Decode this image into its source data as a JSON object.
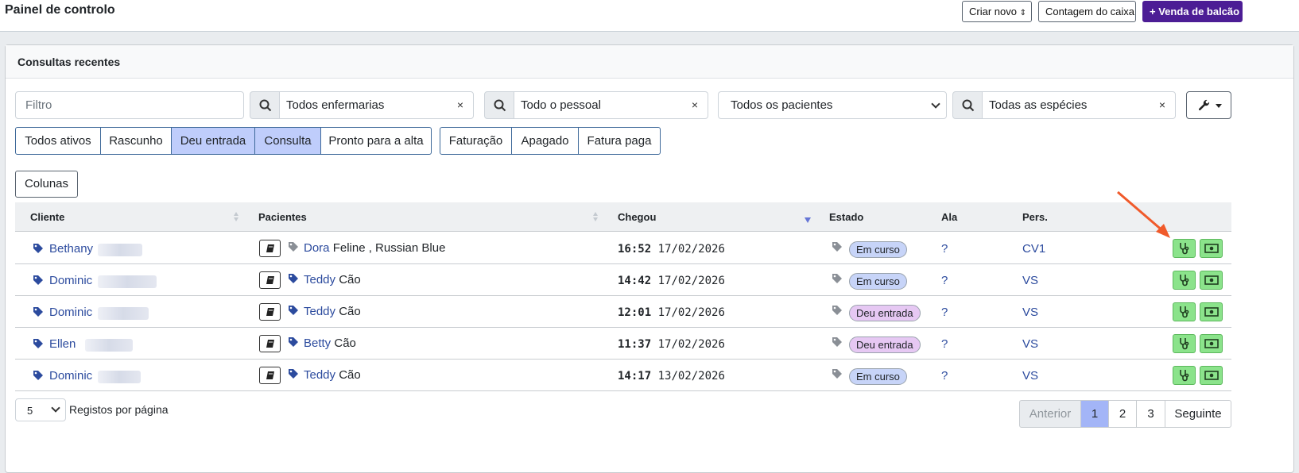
{
  "header": {
    "title": "Painel de controlo",
    "create_label": "Criar novo",
    "cash_count_label": "Contagem do caixa",
    "counter_sale_label": "Venda de balcão",
    "brand_color": "#4c1d95"
  },
  "card": {
    "title": "Consultas recentes"
  },
  "filters": {
    "filter_placeholder": "Filtro",
    "wards": "Todos enfermarias",
    "staff": "Todo o pessoal",
    "patients": "Todos os pacientes",
    "species": "Todas as espécies",
    "clear_glyph": "×"
  },
  "status_tabs": [
    {
      "label": "Todos ativos",
      "active": false
    },
    {
      "label": "Rascunho",
      "active": false
    },
    {
      "label": "Deu entrada",
      "active": true
    },
    {
      "label": "Consulta",
      "active": true
    },
    {
      "label": "Pronto para a alta",
      "active": false
    }
  ],
  "billing_tabs": [
    {
      "label": "Faturação",
      "active": false
    },
    {
      "label": "Apagado",
      "active": false
    },
    {
      "label": "Fatura paga",
      "active": false
    }
  ],
  "columns_button": "Colunas",
  "table": {
    "headers": {
      "client": "Cliente",
      "patients": "Pacientes",
      "arrived": "Chegou",
      "status": "Estado",
      "ward": "Ala",
      "staff": "Pers."
    },
    "rows": [
      {
        "client": "Bethany",
        "patient": "Dora",
        "species": "Feline , Russian Blue",
        "time": "16:52",
        "date": "17/02/2026",
        "status": "Em curso",
        "status_kind": "b1",
        "ward": "?",
        "staff": "CV1"
      },
      {
        "client": "Dominic",
        "patient": "Teddy",
        "species": "Cão",
        "time": "14:42",
        "date": "17/02/2026",
        "status": "Em curso",
        "status_kind": "b1",
        "ward": "?",
        "staff": "VS"
      },
      {
        "client": "Dominic",
        "patient": "Teddy",
        "species": "Cão",
        "time": "12:01",
        "date": "17/02/2026",
        "status": "Deu entrada",
        "status_kind": "b2",
        "ward": "?",
        "staff": "VS"
      },
      {
        "client": "Ellen",
        "patient": "Betty",
        "species": "Cão",
        "time": "11:37",
        "date": "17/02/2026",
        "status": "Deu entrada",
        "status_kind": "b2",
        "ward": "?",
        "staff": "VS"
      },
      {
        "client": "Dominic",
        "patient": "Teddy",
        "species": "Cão",
        "time": "14:17",
        "date": "13/02/2026",
        "status": "Em curso",
        "status_kind": "b1",
        "ward": "?",
        "staff": "VS"
      }
    ]
  },
  "footer": {
    "page_size": "5",
    "page_size_label": "Registos por página",
    "prev_label": "Anterior",
    "pages": [
      "1",
      "2",
      "3"
    ],
    "current_page": "1",
    "next_label": "Seguinte"
  }
}
